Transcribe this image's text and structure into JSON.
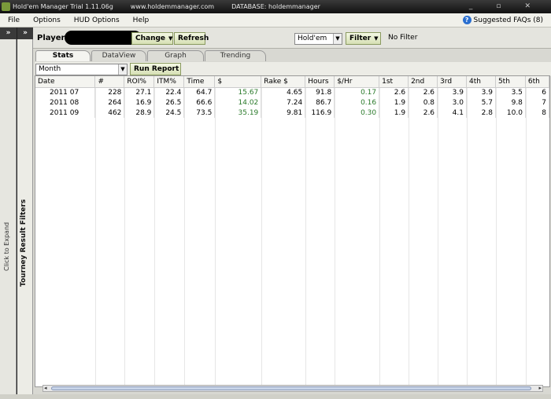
{
  "titlebar": {
    "app_title": "Hold'em Manager Trial 1.11.06g",
    "website": "www.holdemmanager.com",
    "database": "DATABASE: holdemmanager",
    "minimize": "_",
    "maximize": "▫",
    "close": "✕"
  },
  "menu": {
    "items": [
      "File",
      "Options",
      "HUD Options",
      "Help"
    ],
    "faq_label": "Suggested FAQs (8)"
  },
  "left_panel": {
    "expand_glyph": "»",
    "click_to_expand": "Click to Expand"
  },
  "filter_panel": {
    "expand_glyph": "»",
    "title": "Tourney Result Filters"
  },
  "toolbar": {
    "player_label": "Player",
    "site": "(PS)",
    "change_label": "Change",
    "refresh_label": "Refresh",
    "game_type": "Hold'em",
    "filter_label": "Filter",
    "filter_status": "No Filter"
  },
  "tabs": [
    {
      "label": "Stats",
      "active": true
    },
    {
      "label": "DataView",
      "active": false
    },
    {
      "label": "Graph",
      "active": false
    },
    {
      "label": "Trending",
      "active": false
    }
  ],
  "report": {
    "period": "Month",
    "run_label": "Run Report"
  },
  "table": {
    "columns": [
      "Date",
      "#",
      "ROI%",
      "ITM%",
      "Time",
      "$",
      "Rake $",
      "Hours",
      "$/Hr",
      "1st",
      "2nd",
      "3rd",
      "4th",
      "5th",
      "6th"
    ],
    "rows": [
      [
        "2011 07",
        "228",
        "27.1",
        "22.4",
        "64.7",
        "15.67",
        "4.65",
        "91.8",
        "0.17",
        "2.6",
        "2.6",
        "3.9",
        "3.9",
        "3.5",
        "6"
      ],
      [
        "2011 08",
        "264",
        "16.9",
        "26.5",
        "66.6",
        "14.02",
        "7.24",
        "86.7",
        "0.16",
        "1.9",
        "0.8",
        "3.0",
        "5.7",
        "9.8",
        "7"
      ],
      [
        "2011 09",
        "462",
        "28.9",
        "24.5",
        "73.5",
        "35.19",
        "9.81",
        "116.9",
        "0.30",
        "1.9",
        "2.6",
        "4.1",
        "2.8",
        "10.0",
        "8"
      ]
    ]
  },
  "colors": {
    "positive_money": "#2a7a2a",
    "titlebar": "#1a1a1a"
  }
}
